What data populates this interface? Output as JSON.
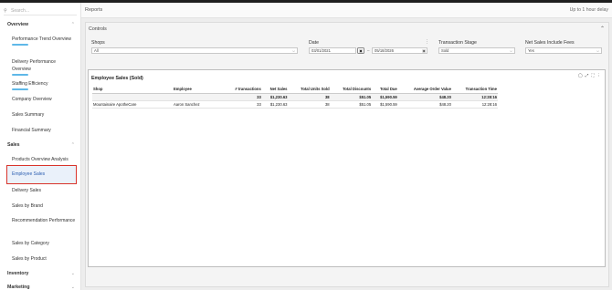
{
  "sidebar": {
    "search_placeholder": "Search...",
    "sections": {
      "overview": "Overview",
      "sales": "Sales",
      "inventory": "Inventory",
      "marketing": "Marketing"
    },
    "overview_items": [
      "Performance Trend Overview",
      "Delivery Performance Overview",
      "Staffing Efficiency",
      "Company Overview",
      "Sales Summary",
      "Financial Summary"
    ],
    "sales_items": [
      "Products Overview Analysis",
      "Employee Sales",
      "Delivery Sales",
      "Sales by Brand",
      "Recommendation Performance",
      "Sales by Category",
      "Sales by Product"
    ],
    "active_item": "Employee Sales"
  },
  "header": {
    "title": "Reports",
    "delay": "Up to 1 hour delay"
  },
  "controls": {
    "title": "Controls",
    "shops_label": "Shops",
    "shops_value": "All",
    "date_label": "Date",
    "date_from": "03/01/2021",
    "date_to": "05/18/2026",
    "stage_label": "Transaction Stage",
    "stage_value": "Sold",
    "fees_label": "Net Sales Include Fees",
    "fees_value": "Yes"
  },
  "table": {
    "title": "Employee Sales (Sold)",
    "columns": [
      "Shop",
      "Employee",
      "# transactions",
      "Net Sales",
      "Total Units Sold",
      "Total Discounts",
      "Total Due",
      "Average Order Value",
      "Transaction Time"
    ],
    "total": [
      "",
      "",
      "33",
      "$1,230.63",
      "38",
      "$51.05",
      "$1,590.59",
      "$48.20",
      "12:28:16"
    ],
    "rows": [
      [
        "Mountainaire ApotheCare",
        "Aaron Sanchez",
        "33",
        "$1,230.63",
        "38",
        "$51.05",
        "$1,590.59",
        "$48.20",
        "12:28:16"
      ]
    ]
  }
}
